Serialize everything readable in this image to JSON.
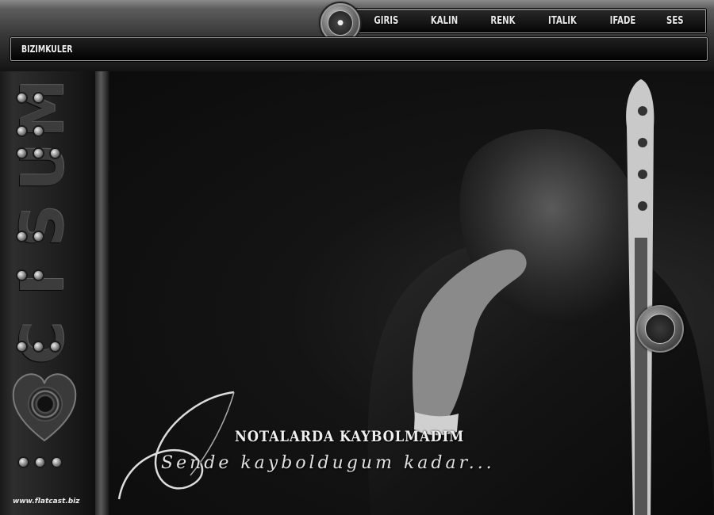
{
  "nav": {
    "items": [
      "GIRIS",
      "KALIN",
      "RENK",
      "ITALIK",
      "IFADE",
      "SES"
    ]
  },
  "breadcrumb": {
    "label": "BIZIMKULER"
  },
  "sidebar": {
    "letters": [
      "M",
      "U",
      "S",
      "I",
      "C"
    ],
    "credit": "www.flatcast.biz"
  },
  "banner": {
    "title": "NOTALARDA KAYBOLMADIM",
    "subtitle": "Sende kayboldugum kadar..."
  },
  "colors": {
    "chrome": "#6a6a6a",
    "text": "#e8e8e8",
    "background": "#0b0b0b"
  },
  "icons": [
    "logo-badge-icon",
    "speaker-icon",
    "heart-icon",
    "rivet-icon",
    "watermark-badge-icon"
  ]
}
